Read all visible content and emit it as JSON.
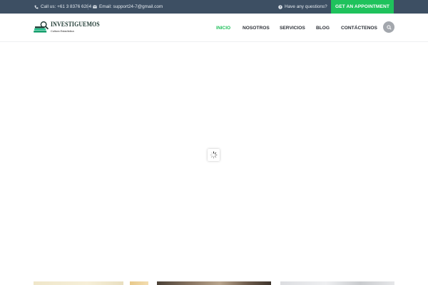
{
  "topbar": {
    "phone": "Call us: +61 3 8376 6284",
    "email": "Email: support24-7@gmail.com",
    "question": "Have any questions?",
    "appointment_button": "GET AN APPOINTMENT",
    "icons": {
      "phone": "phone-icon",
      "email": "envelope-icon",
      "question": "question-circle-icon"
    }
  },
  "logo": {
    "title": "INVESTIGUEMOS",
    "subtitle": "Cultura Estadística"
  },
  "nav": {
    "items": [
      {
        "label": "INICIO",
        "active": true
      },
      {
        "label": "NOSOTROS",
        "active": false
      },
      {
        "label": "SERVICIOS",
        "active": false
      },
      {
        "label": "BLOG",
        "active": false
      },
      {
        "label": "CONTÁCTENOS",
        "active": false
      }
    ],
    "search_icon": "search-icon"
  },
  "loader": {
    "icon": "spinner-icon"
  },
  "colors": {
    "topbar_bg": "#3d4f63",
    "accent_green": "#1fc25c",
    "nav_text": "#2b2f36",
    "search_bg": "#a3a7ad"
  }
}
